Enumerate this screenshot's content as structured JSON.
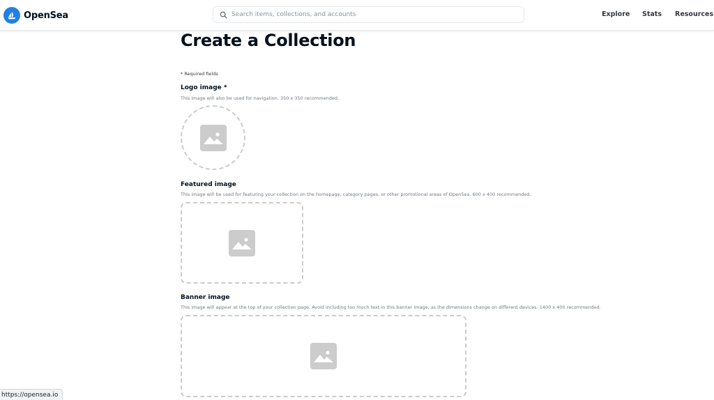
{
  "header": {
    "logo_text": "OpenSea",
    "search_placeholder": "Search items, collections, and accounts",
    "nav": [
      "Explore",
      "Stats",
      "Resources"
    ]
  },
  "main": {
    "title": "Create a Collection",
    "required_note": "* Required fields",
    "logo_image": {
      "label": "Logo image *",
      "description": "This image will also be used for navigation. 350 x 350 recommended."
    },
    "featured_image": {
      "label": "Featured image",
      "description": "This image will be used for featuring your collection on the homepage, category pages, or other promotional areas of OpenSea. 600 x 400 recommended."
    },
    "banner_image": {
      "label": "Banner image",
      "description": "This image will appear at the top of your collection page. Avoid including too much text in this banner image, as the dimensions change on different devices. 1400 x 400 recommended."
    }
  },
  "status_bar": {
    "url": "https://opensea.io"
  },
  "colors": {
    "brand": "#2081e2",
    "text": "#04111d",
    "muted": "#707a83",
    "dashed_border": "#cccccc"
  },
  "icons": [
    "opensea-logo-icon",
    "search-icon",
    "image-placeholder-icon"
  ]
}
